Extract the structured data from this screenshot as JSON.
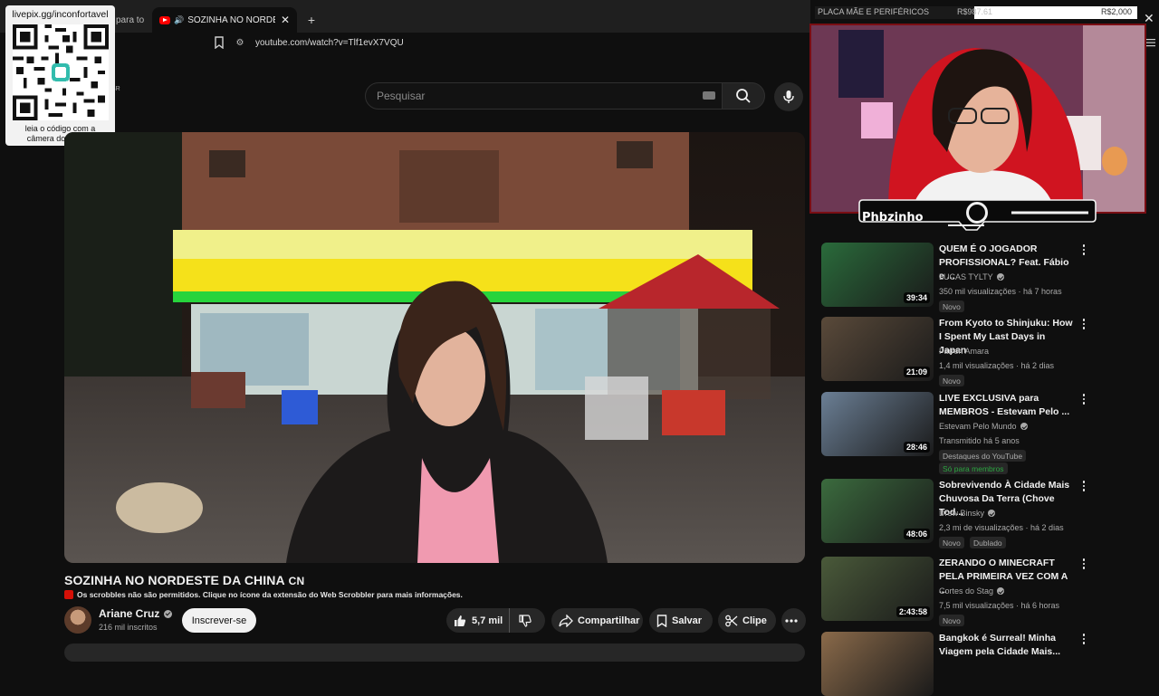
{
  "browser": {
    "left_tab_fragment": "para to",
    "active_tab_title": "SOZINHA NO NORDESTE DA CHINA",
    "new_tab": "+",
    "url": "youtube.com/watch?v=Tlf1evX7VQU"
  },
  "overlay": {
    "qr_url": "livepix.gg/inconfortavel",
    "qr_caption_line1": "leia o código com a",
    "qr_caption_line2": "câmera do celular."
  },
  "youtube": {
    "logo_fragment": "BR",
    "search_placeholder": "Pesquisar"
  },
  "video": {
    "title": "SOZINHA NO NORDESTE DA CHINA",
    "title_flag": "CN",
    "scrobble_notice": "Os scrobbles não são permitidos. Clique no ícone da extensão do Web Scrobbler para mais informações.",
    "channel": "Ariane Cruz",
    "subscribers": "216 mil inscritos",
    "subscribe_label": "Inscrever-se",
    "likes": "5,7 mil",
    "share_label": "Compartilhar",
    "save_label": "Salvar",
    "clip_label": "Clipe"
  },
  "stream": {
    "goal_label": "PLACA MÃE E PERIFÉRICOS",
    "goal_current": "R$987.61",
    "goal_target": "R$2,000",
    "goal_progress": 0.494,
    "streamer_name": "Phbzinho"
  },
  "recommendations": [
    {
      "title": "QUEM É O JOGADOR PROFISSIONAL? Feat. Fábio e ...",
      "channel": "LUCAS TYLTY",
      "verified": true,
      "meta": "350 mil visualizações · há 7 horas",
      "duration": "39:34",
      "badges": [
        "Novo"
      ],
      "thumb_color": "#2a6b3b"
    },
    {
      "title": "From Kyoto to Shinjuku: How I Spent My Last Days in Japan",
      "channel": "Farren Amara",
      "verified": false,
      "meta": "1,4 mil visualizações · há 2 dias",
      "duration": "21:09",
      "badges": [
        "Novo"
      ],
      "thumb_color": "#5a4a3a"
    },
    {
      "title": "LIVE EXCLUSIVA para MEMBROS - Estevam Pelo ...",
      "channel": "Estevam Pelo Mundo",
      "verified": true,
      "meta": "Transmitido há 5 anos",
      "duration": "28:46",
      "badges": [
        "Destaques do YouTube",
        "Só para membros"
      ],
      "thumb_color": "#6b7f95"
    },
    {
      "title": "Sobrevivendo À Cidade Mais Chuvosa Da Terra (Chove Tod...",
      "channel": "Drew Binsky",
      "verified": true,
      "meta": "2,3 mi de visualizações · há 2 dias",
      "duration": "48:06",
      "badges": [
        "Novo",
        "Dublado"
      ],
      "thumb_color": "#3b6b3e"
    },
    {
      "title": "ZERANDO O MINECRAFT PELA PRIMEIRA VEZ COM A ...",
      "channel": "Cortes do Stag",
      "verified": true,
      "meta": "7,5 mil visualizações · há 6 horas",
      "duration": "2:43:58",
      "badges": [
        "Novo"
      ],
      "thumb_color": "#4a5a3a"
    },
    {
      "title": "Bangkok é Surreal! Minha Viagem pela Cidade Mais...",
      "channel": "",
      "verified": false,
      "meta": "",
      "duration": "",
      "badges": [],
      "thumb_color": "#8a6a4a"
    }
  ]
}
